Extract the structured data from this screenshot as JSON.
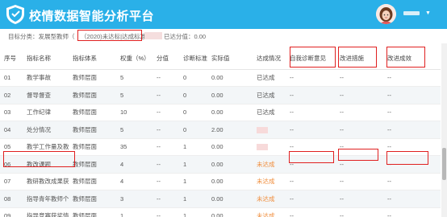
{
  "header": {
    "app_title": "校情数据智能分析平台",
    "user_menu_caret": "▼"
  },
  "subheader": {
    "text_left": "目标分类：发展型教师（",
    "badge_text": "（2020)未达标|达成标准：",
    "text_right": "已达分值：0.00"
  },
  "table": {
    "columns": [
      "序号",
      "指标名称",
      "指标体系",
      "权重（%）",
      "分值",
      "诊断标准",
      "实际值",
      "达成情况",
      "自我诊断意见",
      "改进措施",
      "改进成效"
    ],
    "rows": [
      {
        "no": "01",
        "name": "教学事故",
        "system": "教师层面",
        "weight": "5",
        "score": "--",
        "standard": "0",
        "actual": "0.00",
        "status": "已达成",
        "status_type": "achieved",
        "self_diag": "--",
        "measures": "--",
        "effect": "--"
      },
      {
        "no": "02",
        "name": "督导督查",
        "system": "教师层面",
        "weight": "5",
        "score": "--",
        "standard": "0",
        "actual": "0.00",
        "status": "已达成",
        "status_type": "achieved",
        "self_diag": "--",
        "measures": "--",
        "effect": "--"
      },
      {
        "no": "03",
        "name": "工作纪律",
        "system": "教师层面",
        "weight": "10",
        "score": "--",
        "standard": "0",
        "actual": "0.00",
        "status": "已达成",
        "status_type": "achieved",
        "self_diag": "--",
        "measures": "--",
        "effect": "--"
      },
      {
        "no": "04",
        "name": "处分情况",
        "system": "教师层面",
        "weight": "5",
        "score": "--",
        "standard": "0",
        "actual": "2.00",
        "status": "",
        "status_type": "masked",
        "self_diag": "--",
        "measures": "--",
        "effect": "--"
      },
      {
        "no": "05",
        "name": "教学工作量及教...",
        "system": "教师层面",
        "weight": "35",
        "score": "--",
        "standard": "1",
        "actual": "0.00",
        "status": "",
        "status_type": "masked",
        "self_diag": "--",
        "measures": "--",
        "effect": "--"
      },
      {
        "no": "06",
        "name": "教改课题",
        "system": "教师层面",
        "weight": "4",
        "score": "--",
        "standard": "1",
        "actual": "0.00",
        "status": "未达成",
        "status_type": "unachieved",
        "self_diag": "--",
        "measures": "--",
        "effect": "--"
      },
      {
        "no": "07",
        "name": "教研教改成果获...",
        "system": "教师层面",
        "weight": "4",
        "score": "--",
        "standard": "1",
        "actual": "0.00",
        "status": "未达成",
        "status_type": "unachieved",
        "self_diag": "--",
        "measures": "--",
        "effect": "--"
      },
      {
        "no": "08",
        "name": "指导青年教师个...",
        "system": "教师层面",
        "weight": "3",
        "score": "--",
        "standard": "1",
        "actual": "0.00",
        "status": "未达成",
        "status_type": "unachieved",
        "self_diag": "--",
        "measures": "--",
        "effect": "--"
      },
      {
        "no": "09",
        "name": "指导竞赛获奖情...",
        "system": "教师层面",
        "weight": "1",
        "score": "--",
        "standard": "1",
        "actual": "0.00",
        "status": "未达成",
        "status_type": "unachieved",
        "self_diag": "--",
        "measures": "--",
        "effect": "--"
      }
    ]
  },
  "colors": {
    "header_bg": "#2ab0e8",
    "annotation_red": "#e02020",
    "unachieved_orange": "#f08c3a"
  },
  "icons": {
    "logo": "shield-logo-icon",
    "avatar": "user-avatar-icon",
    "caret": "chevron-down-icon"
  }
}
